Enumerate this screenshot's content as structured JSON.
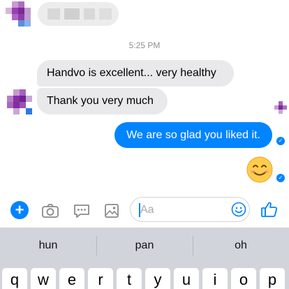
{
  "conversation": {
    "timestamp": "5:25 PM",
    "incoming_messages": [
      "Handvo is excellent... very healthy",
      "Thank you very much"
    ],
    "outgoing_message": "We are so glad you liked it.",
    "reaction_emoji": "😊"
  },
  "composer": {
    "placeholder": "Aa",
    "icons": [
      "plus-icon",
      "camera-icon",
      "chat-bubble-icon",
      "image-icon",
      "emoji-icon",
      "thumbs-up-icon"
    ],
    "accent_color": "#0084ff"
  },
  "keyboard": {
    "suggestions": [
      "hun",
      "pan",
      "oh"
    ],
    "row1_keys": [
      "q",
      "w",
      "e",
      "r",
      "t",
      "y",
      "u",
      "i",
      "o",
      "p"
    ]
  }
}
